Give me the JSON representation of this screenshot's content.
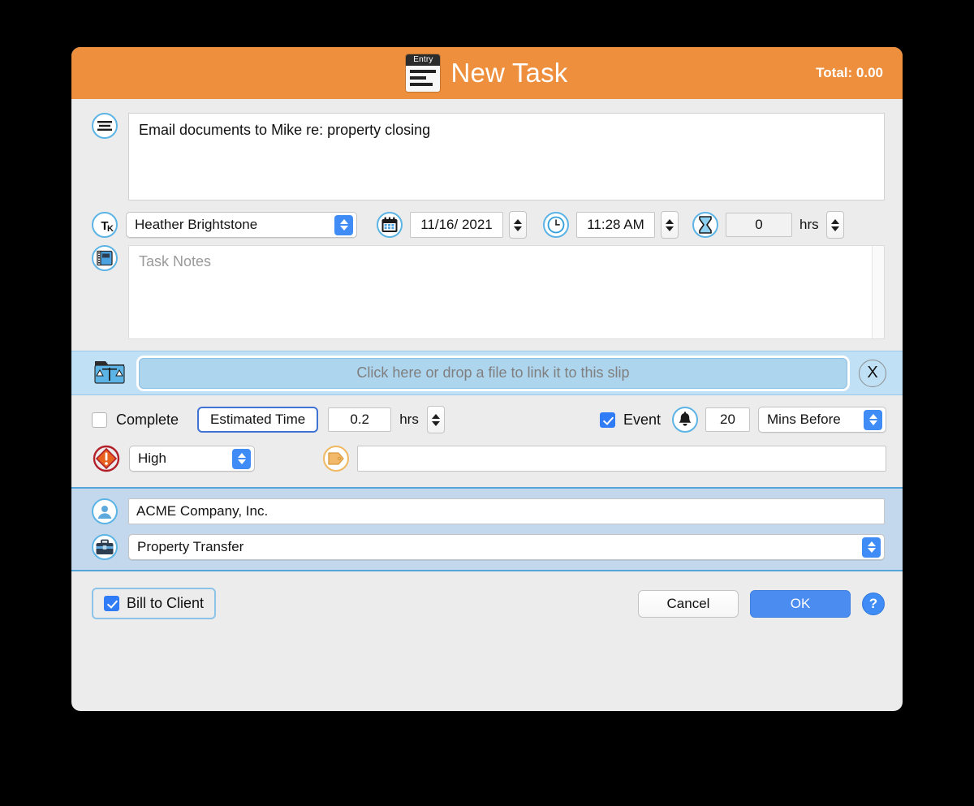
{
  "window": {
    "title": "New Task",
    "total_label": "Total: 0.00",
    "entry_icon_caption": "Entry",
    "accent_orange": "#ee8f3d",
    "accent_blue": "#3f8cf6",
    "file_band_blue": "#bfe0f5",
    "client_band_blue": "#c3d8ec"
  },
  "description": {
    "icon": "description-lines-icon",
    "value": "Email documents to Mike re: property closing"
  },
  "meta": {
    "timekeeper": {
      "icon": "timekeeper-tk-icon",
      "value": "Heather Brightstone"
    },
    "date": {
      "icon": "calendar-icon",
      "value": "11/16/ 2021"
    },
    "time": {
      "icon": "clock-icon",
      "value": "11:28 AM"
    },
    "hours": {
      "icon": "hourglass-icon",
      "value": "0",
      "unit": "hrs"
    }
  },
  "notes": {
    "icon": "notebook-icon",
    "value": "",
    "placeholder": "Task Notes"
  },
  "file_link": {
    "icon": "folder-scales-icon",
    "dropzone_text": "Click here or drop a file to link it to this slip",
    "clear_label": "X"
  },
  "options": {
    "complete": {
      "label": "Complete",
      "checked": false
    },
    "estimated_time_button": "Estimated Time",
    "estimated_value": "0.2",
    "estimated_unit": "hrs",
    "event": {
      "label": "Event",
      "checked": true
    },
    "reminder": {
      "icon": "bell-icon",
      "value": "20",
      "unit_selected": "Mins Before"
    },
    "priority": {
      "icon": "priority-alert-icon",
      "value": "High"
    },
    "tag": {
      "icon": "tag-icon",
      "value": ""
    }
  },
  "client_section": {
    "client": {
      "icon": "person-icon",
      "value": "ACME Company, Inc."
    },
    "matter": {
      "icon": "briefcase-icon",
      "value": "Property Transfer"
    }
  },
  "footer": {
    "bill_to_client": {
      "label": "Bill to Client",
      "checked": true
    },
    "cancel_label": "Cancel",
    "ok_label": "OK",
    "help_label": "?"
  }
}
